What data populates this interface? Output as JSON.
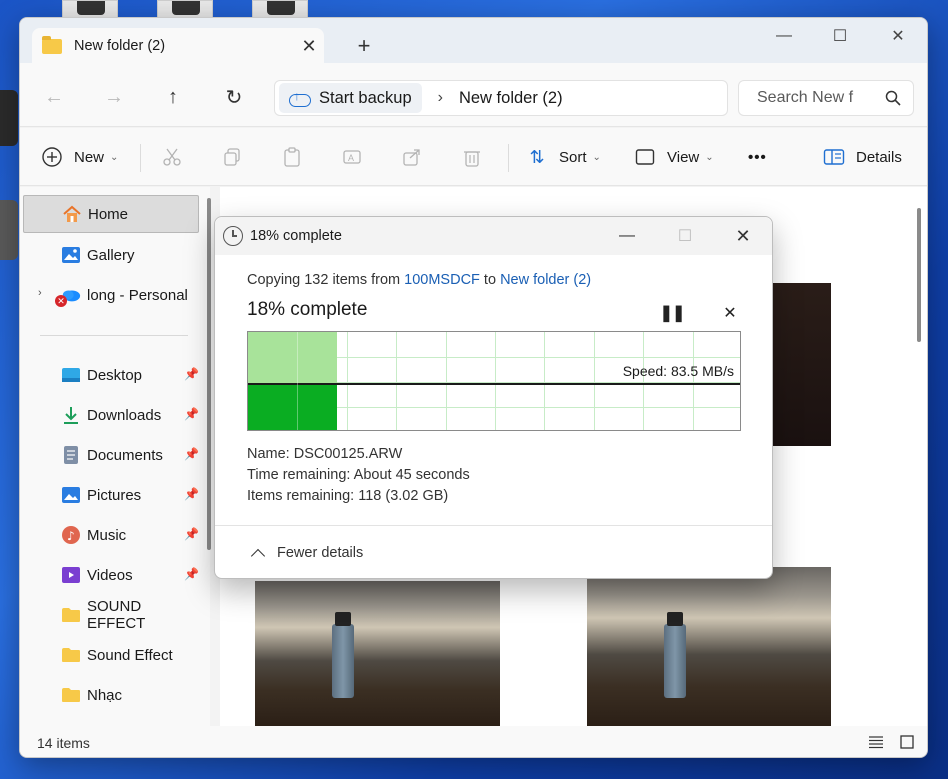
{
  "explorer": {
    "tab_title": "New folder (2)",
    "window_controls": {
      "minimize": "—",
      "maximize": "☐",
      "close": "✕"
    },
    "address": {
      "backup_label": "Start backup",
      "path": "New folder (2)"
    },
    "search": {
      "placeholder": "Search New f"
    },
    "toolbar": {
      "new_label": "New",
      "sort_label": "Sort",
      "view_label": "View",
      "details_label": "Details",
      "more_label": "•••"
    },
    "sidebar": {
      "items": [
        {
          "label": "Home",
          "icon": "home-icon"
        },
        {
          "label": "Gallery",
          "icon": "gallery-icon"
        },
        {
          "label": "long - Personal",
          "icon": "onedrive-cloud-icon"
        },
        {
          "label": "Desktop",
          "icon": "desktop-icon",
          "pinned": true
        },
        {
          "label": "Downloads",
          "icon": "download-icon",
          "pinned": true
        },
        {
          "label": "Documents",
          "icon": "document-icon",
          "pinned": true
        },
        {
          "label": "Pictures",
          "icon": "pictures-icon",
          "pinned": true
        },
        {
          "label": "Music",
          "icon": "music-icon",
          "pinned": true
        },
        {
          "label": "Videos",
          "icon": "videos-icon",
          "pinned": true
        },
        {
          "label": "SOUND EFFECT",
          "icon": "folder-icon"
        },
        {
          "label": "Sound Effect",
          "icon": "folder-icon"
        },
        {
          "label": "Nhạc",
          "icon": "folder-icon"
        }
      ]
    },
    "status": {
      "item_count": "14 items"
    }
  },
  "copy_dialog": {
    "title": "18% complete",
    "copy_prefix": "Copying 132 items from ",
    "source": "100MSDCF",
    "copy_mid": " to ",
    "destination": "New folder (2)",
    "progress_heading": "18% complete",
    "progress_fraction": 0.18,
    "speed": "Speed: 83.5 MB/s",
    "name_label": "Name:",
    "name_value": "DSC00125.ARW",
    "time_label": "Time remaining:",
    "time_value": "About 45 seconds",
    "items_label": "Items remaining:",
    "items_value": "118 (3.02 GB)",
    "fewer_details": "Fewer details"
  },
  "colors": {
    "graph_fill_light": "#a8e39a",
    "graph_fill_dark": "#0aad22",
    "link": "#1a5fb4",
    "desktop_bg": "#1b55c6"
  }
}
